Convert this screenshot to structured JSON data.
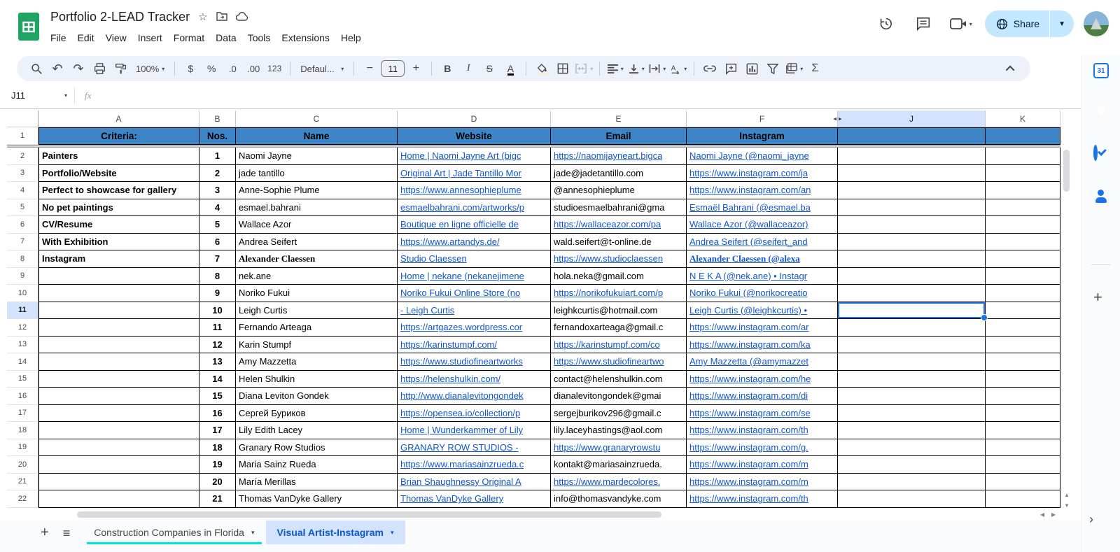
{
  "header": {
    "title": "Portfolio 2-LEAD Tracker",
    "menus": [
      "File",
      "Edit",
      "View",
      "Insert",
      "Format",
      "Data",
      "Tools",
      "Extensions",
      "Help"
    ],
    "share_label": "Share"
  },
  "toolbar": {
    "zoom": "100%",
    "currency": "$",
    "percent": "%",
    "decrease_decimal": ".0",
    "increase_decimal": ".00",
    "more_formats": "123",
    "font": "Defaul...",
    "font_size": "11",
    "bold": "B",
    "italic": "I",
    "strikethrough": "S",
    "text_color": "A",
    "functions": "Σ"
  },
  "formula_bar": {
    "name_box": "J11",
    "fx_label": "fx"
  },
  "grid": {
    "col_letters": [
      "A",
      "B",
      "C",
      "D",
      "E",
      "F",
      "J",
      "K"
    ],
    "header_labels": [
      "Criteria:",
      "Nos.",
      "Name",
      "Website",
      "Email",
      "Instagram",
      "",
      ""
    ],
    "rows": [
      {
        "n": "1",
        "criteria": "Painters",
        "name": "Naomi Jayne",
        "website": "Home | Naomi Jayne Art (bigc",
        "email": "https://naomijayneart.bigca",
        "email_link": true,
        "instagram": "Naomi Jayne (@naomi_jayne"
      },
      {
        "n": "2",
        "criteria": "Portfolio/Website",
        "name": "jade tantillo",
        "website": "Original Art | Jade Tantillo Mor",
        "email": "jade@jadetantillo.com",
        "email_link": false,
        "instagram": "https://www.instagram.com/ja"
      },
      {
        "n": "3",
        "criteria": "Perfect to showcase for gallery",
        "name": "Anne-Sophie Plume",
        "website": "https://www.annesophieplume",
        "email": "@annesophieplume",
        "email_link": false,
        "instagram": "https://www.instagram.com/an"
      },
      {
        "n": "4",
        "criteria": "No pet paintings",
        "name": "esmael.bahrani",
        "website": "esmaelbahrani.com/artworks/p",
        "email": "studioesmaelbahrani@gma",
        "email_link": false,
        "instagram": "Esmaël Bahrani (@esmael.ba"
      },
      {
        "n": "5",
        "criteria": "CV/Resume",
        "name": "Wallace Azor",
        "website": "Boutique en ligne officielle de",
        "email": "https://wallaceazor.com/pa",
        "email_link": true,
        "instagram": "Wallace Azor (@wallaceazor)"
      },
      {
        "n": "6",
        "criteria": "With Exhibition",
        "name": "Andrea Seifert",
        "website": "https://www.artandys.de/",
        "email": "wald.seifert@t-online.de",
        "email_link": false,
        "instagram": "Andrea Seifert (@seifert_and"
      },
      {
        "n": "7",
        "criteria": "Instagram",
        "name": "Alexander Claessen",
        "website": "Studio Claessen",
        "email": "https://www.studioclaessen",
        "email_link": true,
        "instagram": "Alexander Claessen (@alexa",
        "emph": true
      },
      {
        "n": "8",
        "criteria": "",
        "name": "nek.ane",
        "website": "Home | nekane (nekanejimene",
        "email": "hola.neka@gmail.com",
        "email_link": false,
        "instagram": "N E K A (@nek.ane) • Instagr"
      },
      {
        "n": "9",
        "criteria": "",
        "name": "Noriko Fukui",
        "website": "Noriko Fukui Online Store (no",
        "email": "https://norikofukuiart.com/p",
        "email_link": true,
        "instagram": "Noriko Fukui (@norikocreatio"
      },
      {
        "n": "10",
        "criteria": "",
        "name": "Leigh Curtis",
        "website": "- Leigh Curtis",
        "email": "leighkcurtis@hotmail.com",
        "email_link": false,
        "instagram": "Leigh Curtis (@leighkcurtis) •",
        "selected": true
      },
      {
        "n": "11",
        "criteria": "",
        "name": "Fernando Arteaga",
        "website": "https://artgazes.wordpress.cor",
        "email": "fernandoxarteaga@gmail.c",
        "email_link": false,
        "instagram": "https://www.instagram.com/ar"
      },
      {
        "n": "12",
        "criteria": "",
        "name": "Karin Stumpf",
        "website": "https://karinstumpf.com/",
        "email": "https://karinstumpf.com/co",
        "email_link": true,
        "instagram": "https://www.instagram.com/ka"
      },
      {
        "n": "13",
        "criteria": "",
        "name": "Amy Mazzetta",
        "website": "https://www.studiofineartworks",
        "email": "https://www.studiofineartwo",
        "email_link": true,
        "instagram": "Amy Mazzetta (@amymazzet"
      },
      {
        "n": "14",
        "criteria": "",
        "name": "Helen Shulkin",
        "website": "https://helenshulkin.com/",
        "email": "contact@helenshulkin.com",
        "email_link": false,
        "instagram": "https://www.instagram.com/he"
      },
      {
        "n": "15",
        "criteria": "",
        "name": "Diana Leviton Gondek",
        "website": "http://www.dianalevitongondek",
        "email": "dianalevitongondek@gmai",
        "email_link": false,
        "instagram": "https://www.instagram.com/di"
      },
      {
        "n": "16",
        "criteria": "",
        "name": "Сергей Буриков",
        "website": "https://opensea.io/collection/p",
        "email": "sergejburikov296@gmail.c",
        "email_link": false,
        "instagram": "https://www.instagram.com/se"
      },
      {
        "n": "17",
        "criteria": "",
        "name": "Lily Edith Lacey",
        "website": "Home | Wunderkammer of Lily",
        "email": "lily.laceyhastings@aol.com",
        "email_link": false,
        "instagram": "https://www.instagram.com/th"
      },
      {
        "n": "18",
        "criteria": "",
        "name": "Granary Row Studios",
        "website": "GRANARY ROW STUDIOS -",
        "email": "https://www.granaryrowstu",
        "email_link": true,
        "instagram": "https://www.instagram.com/g."
      },
      {
        "n": "19",
        "criteria": "",
        "name": "Maria Sainz Rueda",
        "website": "https://www.mariasainzrueda.c",
        "email": "kontakt@mariasainzrueda.",
        "email_link": false,
        "instagram": "https://www.instagram.com/m"
      },
      {
        "n": "20",
        "criteria": "",
        "name": "María Merillas",
        "website": "Brian Shaughnessy Original A",
        "email": "https://www.mardecolores.",
        "email_link": true,
        "instagram": "https://www.instagram.com/m"
      },
      {
        "n": "21",
        "criteria": "",
        "name": "Thomas VanDyke Gallery",
        "website": "Thomas VanDyke Gallery",
        "email": "info@thomasvandyke.com",
        "email_link": false,
        "instagram": "https://www.instagram.com/th"
      }
    ]
  },
  "tabs": [
    {
      "label": "Construction Companies in Florida",
      "active": false,
      "tab_color": "#00e3e3"
    },
    {
      "label": "Visual Artist-Instagram",
      "active": true
    }
  ],
  "side_panel": {
    "icons": [
      "calendar",
      "keep",
      "tasks",
      "contacts",
      "maps",
      "add"
    ]
  },
  "colors": {
    "table_header_blue": "#3d85c6",
    "link_blue": "#1155cc",
    "selection_blue": "#1a73e8",
    "share_pill": "#c2e7ff",
    "active_tab_bg": "#d3e3fd"
  }
}
